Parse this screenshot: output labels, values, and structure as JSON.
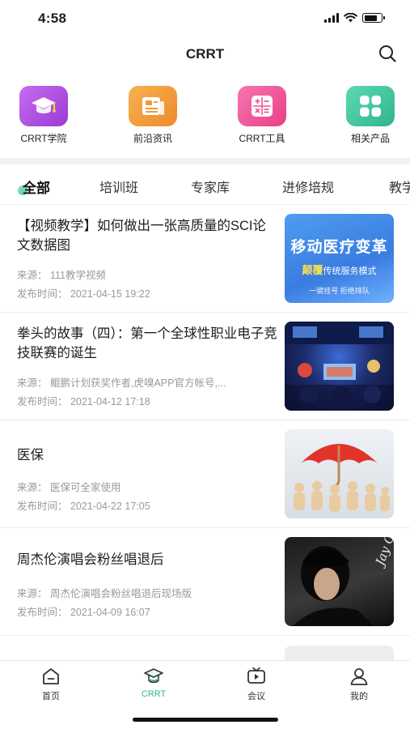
{
  "status_bar": {
    "time": "4:58"
  },
  "nav": {
    "title": "CRRT",
    "search_icon": "search-icon"
  },
  "shortcuts": [
    {
      "label": "CRRT学院",
      "icon": "graduation-cap-icon",
      "color": "#b24fe0"
    },
    {
      "label": "前沿资讯",
      "icon": "newspaper-icon",
      "color": "#f19a3b"
    },
    {
      "label": "CRRT工具",
      "icon": "calculator-icon",
      "color": "#f0559a"
    },
    {
      "label": "相关产品",
      "icon": "grid-icon",
      "color": "#37c19a"
    }
  ],
  "tabs": [
    "全部",
    "培训班",
    "专家库",
    "进修培规",
    "教学"
  ],
  "active_tab": "全部",
  "articles": [
    {
      "title": "【视频教学】如何做出一张高质量的SCI论文数据图",
      "source": "来源： 111教学视频",
      "time": "发布时间： 2021-04-15 19:22",
      "thumb": {
        "big": "移动医疗变革",
        "mid_a": "颠覆",
        "mid_b": "传统服务模式",
        "small": "一键挂号 拒绝排队"
      }
    },
    {
      "title": "拳头的故事（四）：第一个全球性职业电子竞技联赛的诞生",
      "source": "来源： 鲲鹏计划获奖作者,虎嗅APP官方帐号,...",
      "time": "发布时间： 2021-04-12 17:18"
    },
    {
      "title": "医保",
      "source": "来源： 医保可全家使用",
      "time": "发布时间： 2021-04-22 17:05"
    },
    {
      "title": "周杰伦演唱会粉丝唱退后",
      "source": "来源： 周杰伦演唱会粉丝唱退后现场版",
      "time": "发布时间： 2021-04-09 16:07",
      "thumb": {
        "text": "Jay Chou"
      }
    }
  ],
  "tab_bar": [
    {
      "label": "首页",
      "icon": "home-icon"
    },
    {
      "label": "CRRT",
      "icon": "graduation-cap-icon",
      "active": true,
      "color": "#2bb592"
    },
    {
      "label": "会议",
      "icon": "tv-play-icon"
    },
    {
      "label": "我的",
      "icon": "person-icon"
    }
  ]
}
